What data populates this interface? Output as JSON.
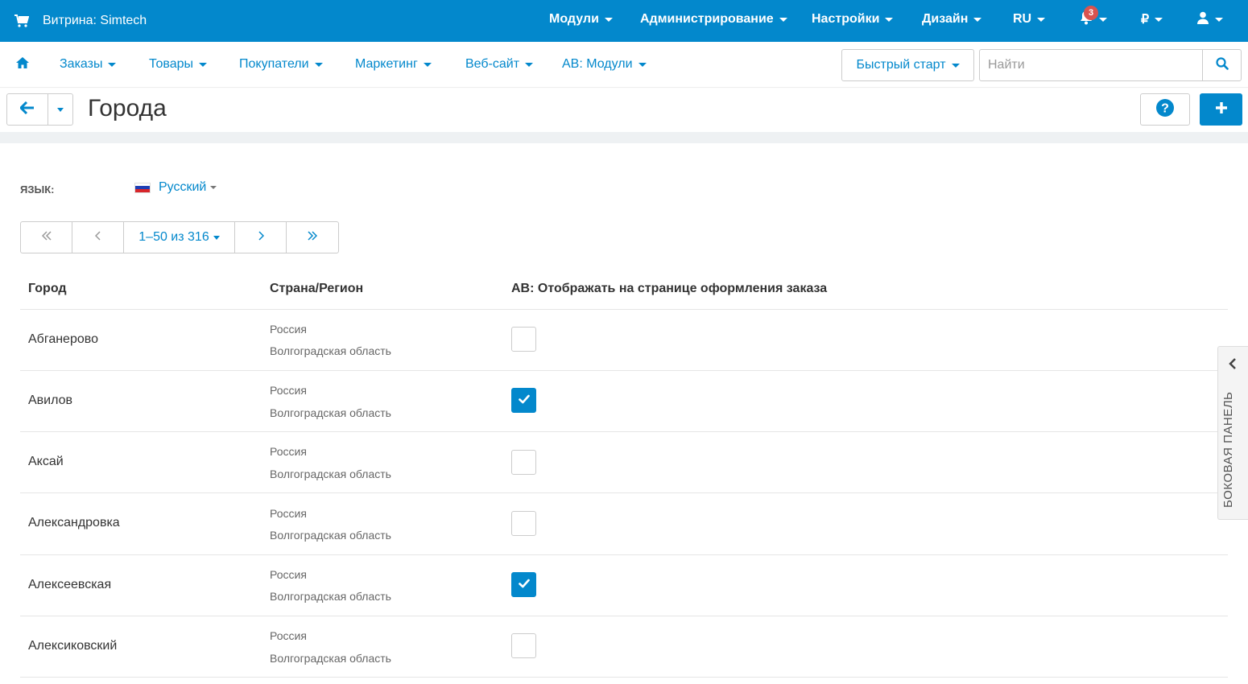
{
  "topbar": {
    "storefront": "Витрина: Simtech",
    "nav": [
      "Модули",
      "Администрирование",
      "Настройки",
      "Дизайн",
      "RU"
    ],
    "notifications_count": "3",
    "currency": "₽"
  },
  "subnav": {
    "items": [
      "Заказы",
      "Товары",
      "Покупатели",
      "Маркетинг",
      "Веб-сайт",
      "AB: Модули"
    ],
    "quickstart": "Быстрый старт",
    "search_placeholder": "Найти"
  },
  "page": {
    "title": "Города"
  },
  "language": {
    "label": "Язык:",
    "value": "Русский"
  },
  "pagination": {
    "range": "1–50 из 316"
  },
  "table": {
    "headers": [
      "Город",
      "Страна/Регион",
      "AB: Отображать на странице оформления заказа"
    ],
    "rows": [
      {
        "city": "Абганерово",
        "country": "Россия",
        "region": "Волгоградская область",
        "checked": false
      },
      {
        "city": "Авилов",
        "country": "Россия",
        "region": "Волгоградская область",
        "checked": true
      },
      {
        "city": "Аксай",
        "country": "Россия",
        "region": "Волгоградская область",
        "checked": false
      },
      {
        "city": "Александровка",
        "country": "Россия",
        "region": "Волгоградская область",
        "checked": false
      },
      {
        "city": "Алексеевская",
        "country": "Россия",
        "region": "Волгоградская область",
        "checked": true
      },
      {
        "city": "Алексиковский",
        "country": "Россия",
        "region": "Волгоградская область",
        "checked": false
      }
    ]
  },
  "sidepanel": {
    "label": "Боковая панель"
  },
  "colors": {
    "accent": "#0388cc",
    "badge": "#d9534f"
  }
}
